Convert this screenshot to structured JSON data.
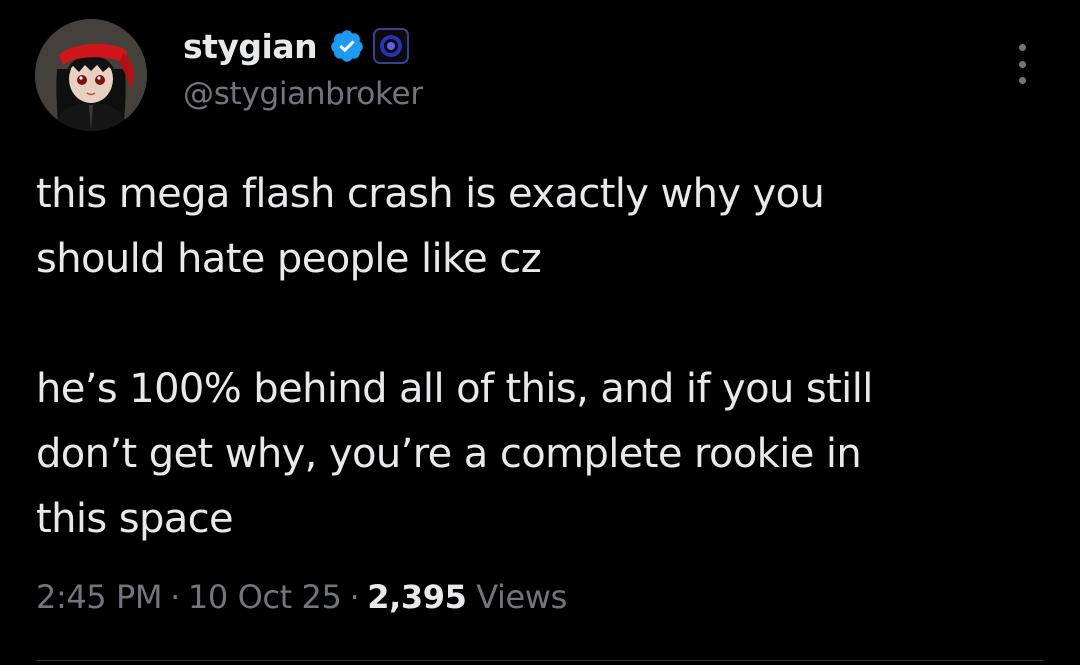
{
  "author": {
    "display_name": "stygian",
    "handle": "@stygianbroker",
    "avatar_icon": "avatar-image",
    "verified_icon": "verified-badge-icon",
    "affiliate_icon": "affiliate-badge-icon"
  },
  "tweet": {
    "paragraphs": [
      "this mega flash crash is exactly why you\nshould hate people like cz",
      "he’s 100% behind all of this, and if you still\ndon’t get why, you’re a complete rookie in\nthis space"
    ],
    "time": "2:45 PM",
    "date": "10 Oct 25",
    "separator": "·",
    "views_count": "2,395",
    "views_label": "Views"
  },
  "menu": {
    "icon": "more-options-icon"
  },
  "colors": {
    "background": "#000000",
    "text": "#e7e9ea",
    "secondary_text": "#71767b",
    "verified_blue": "#1d9bf0"
  }
}
